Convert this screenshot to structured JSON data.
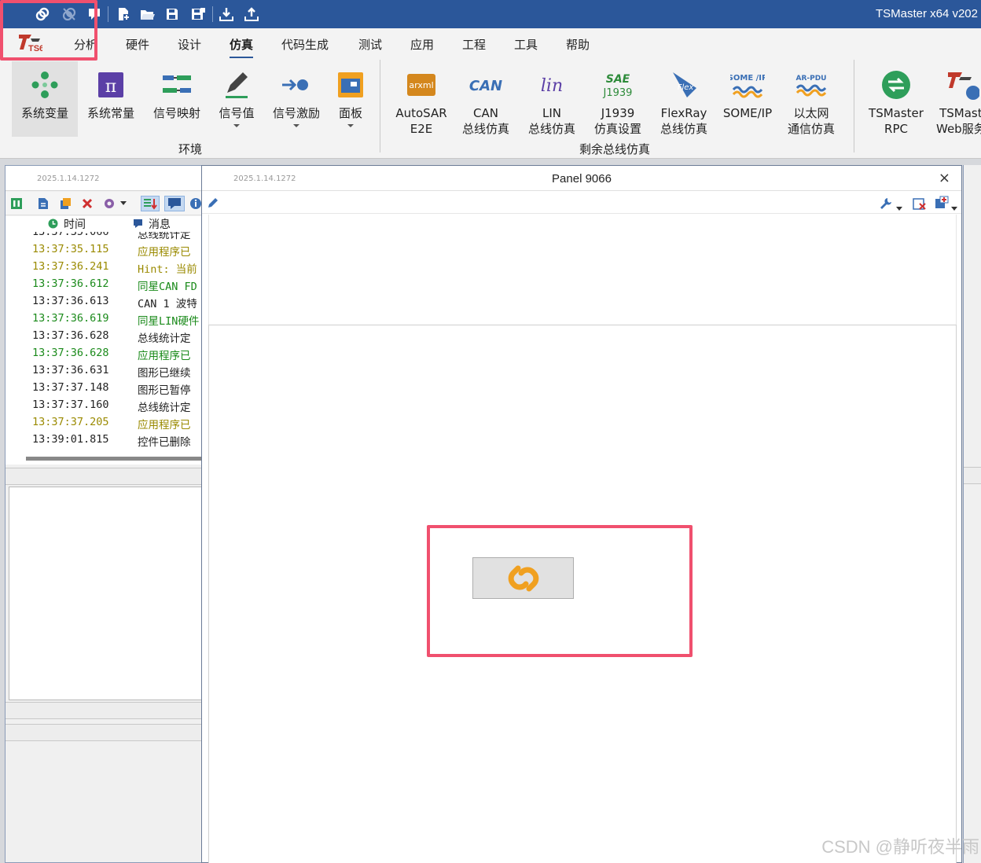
{
  "app_title": "TSMaster x64 v202",
  "colors": {
    "titlebar": "#2b579a",
    "highlight_box": "#f0506e",
    "link_icon": "#f0a020"
  },
  "quick_access": [
    {
      "icon": "link-icon"
    },
    {
      "icon": "unlink-icon"
    },
    {
      "icon": "comment-icon"
    },
    {
      "icon": "new-project-icon"
    },
    {
      "icon": "open-folder-icon"
    },
    {
      "icon": "save-icon"
    },
    {
      "icon": "save-as-icon"
    },
    {
      "icon": "download-icon"
    },
    {
      "icon": "upload-icon"
    }
  ],
  "menu": {
    "logo": "TS64",
    "items": [
      "分析",
      "硬件",
      "设计",
      "仿真",
      "代码生成",
      "测试",
      "应用",
      "工程",
      "工具",
      "帮助"
    ],
    "active": "仿真"
  },
  "ribbon": {
    "buttons": [
      {
        "label": "系统变量",
        "icon": "system-variables-icon"
      },
      {
        "label": "系统常量",
        "icon": "pi-constant-icon"
      },
      {
        "label": "信号映射",
        "icon": "signal-mapping-icon"
      },
      {
        "label": "信号值",
        "icon": "pencil-icon"
      },
      {
        "label": "信号激励",
        "icon": "signal-stimulus-icon"
      },
      {
        "label": "面板",
        "icon": "panel-icon"
      },
      {
        "label1": "AutoSAR",
        "label2": "E2E",
        "icon": "arxml-icon",
        "icon_text": "arxml"
      },
      {
        "label1": "CAN",
        "label2": "总线仿真",
        "icon": "can-icon",
        "icon_text": "CAN"
      },
      {
        "label1": "LIN",
        "label2": "总线仿真",
        "icon": "lin-icon",
        "icon_text": "lin"
      },
      {
        "label1": "J1939",
        "label2": "仿真设置",
        "icon": "sae-j1939-icon",
        "icon_text1": "SAE",
        "icon_text2": "J1939"
      },
      {
        "label1": "FlexRay",
        "label2": "总线仿真",
        "icon": "flexray-icon",
        "icon_text": "Flex"
      },
      {
        "label": "SOME/IP",
        "icon": "someip-icon",
        "icon_text": "SOME /IP"
      },
      {
        "label1": "以太网",
        "label2": "通信仿真",
        "icon": "ar-pdu-icon",
        "icon_text": "AR-PDU"
      },
      {
        "label1": "TSMaster",
        "label2": "RPC",
        "icon": "rpc-icon"
      },
      {
        "label1": "TSMast",
        "label2": "Web服务",
        "icon": "web-service-icon"
      }
    ],
    "groups": [
      "环境",
      "剩余总线仿真"
    ]
  },
  "message_window": {
    "version": "2025.1.14.1272",
    "columns": [
      "时间",
      "消息"
    ],
    "rows": [
      {
        "time": "13:37:35.066",
        "msg": "总线统计定",
        "color": "#222222"
      },
      {
        "time": "13:37:35.115",
        "msg": "应用程序已",
        "color": "#9a8a00"
      },
      {
        "time": "13:37:36.241",
        "msg": "Hint: 当前",
        "color": "#9a8a00"
      },
      {
        "time": "13:37:36.612",
        "msg": "同星CAN FD",
        "color": "#1a8a1a"
      },
      {
        "time": "13:37:36.613",
        "msg": "CAN 1 波特",
        "color": "#222222"
      },
      {
        "time": "13:37:36.619",
        "msg": "同星LIN硬件",
        "color": "#1a8a1a"
      },
      {
        "time": "13:37:36.628",
        "msg": "总线统计定",
        "color": "#222222"
      },
      {
        "time": "13:37:36.628",
        "msg": "应用程序已",
        "color": "#1a8a1a"
      },
      {
        "time": "13:37:36.631",
        "msg": "图形已继续",
        "color": "#222222"
      },
      {
        "time": "13:37:37.148",
        "msg": "图形已暂停",
        "color": "#222222"
      },
      {
        "time": "13:37:37.160",
        "msg": "总线统计定",
        "color": "#222222"
      },
      {
        "time": "13:37:37.205",
        "msg": "应用程序已",
        "color": "#9a8a00"
      },
      {
        "time": "13:39:01.815",
        "msg": "控件已删除",
        "color": "#222222"
      }
    ]
  },
  "panel_window": {
    "version": "2025.1.14.1272",
    "title": "Panel 9066",
    "close": "×",
    "button_icon": "link-icon"
  },
  "watermark": "CSDN @静听夜半雨"
}
